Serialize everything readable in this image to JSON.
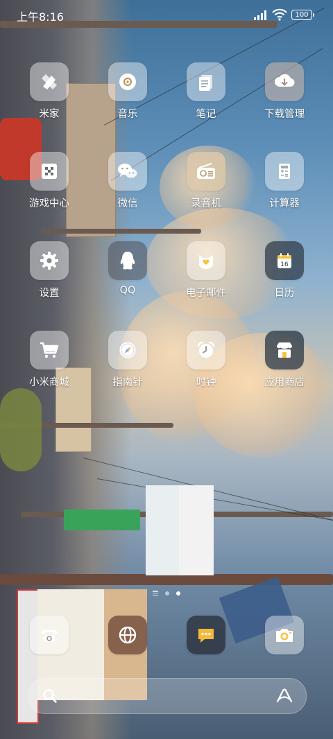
{
  "status_bar": {
    "time": "上午8:16",
    "battery": "100"
  },
  "apps": [
    {
      "label": "米家",
      "icon": "mijia-icon"
    },
    {
      "label": "音乐",
      "icon": "music-icon"
    },
    {
      "label": "笔记",
      "icon": "notes-icon"
    },
    {
      "label": "下载管理",
      "icon": "download-icon"
    },
    {
      "label": "游戏中心",
      "icon": "game-center-icon"
    },
    {
      "label": "微信",
      "icon": "wechat-icon"
    },
    {
      "label": "录音机",
      "icon": "recorder-icon"
    },
    {
      "label": "计算器",
      "icon": "calculator-icon"
    },
    {
      "label": "设置",
      "icon": "settings-gear-icon"
    },
    {
      "label": "QQ",
      "icon": "qq-penguin-icon"
    },
    {
      "label": "电子邮件",
      "icon": "email-icon"
    },
    {
      "label": "日历",
      "icon": "calendar-icon",
      "date": "16"
    },
    {
      "label": "小米商城",
      "icon": "shopping-cart-icon"
    },
    {
      "label": "指南针",
      "icon": "compass-icon"
    },
    {
      "label": "时钟",
      "icon": "alarm-clock-icon"
    },
    {
      "label": "应用商店",
      "icon": "app-store-icon"
    }
  ],
  "page_indicator": {
    "pages": 2,
    "current": 2
  },
  "dock": [
    {
      "icon": "phone-icon"
    },
    {
      "icon": "browser-icon"
    },
    {
      "icon": "messages-icon"
    },
    {
      "icon": "camera-icon"
    }
  ],
  "colors": {
    "accent_yellow": "#f5c342",
    "message_yellow": "#f5b93a"
  }
}
